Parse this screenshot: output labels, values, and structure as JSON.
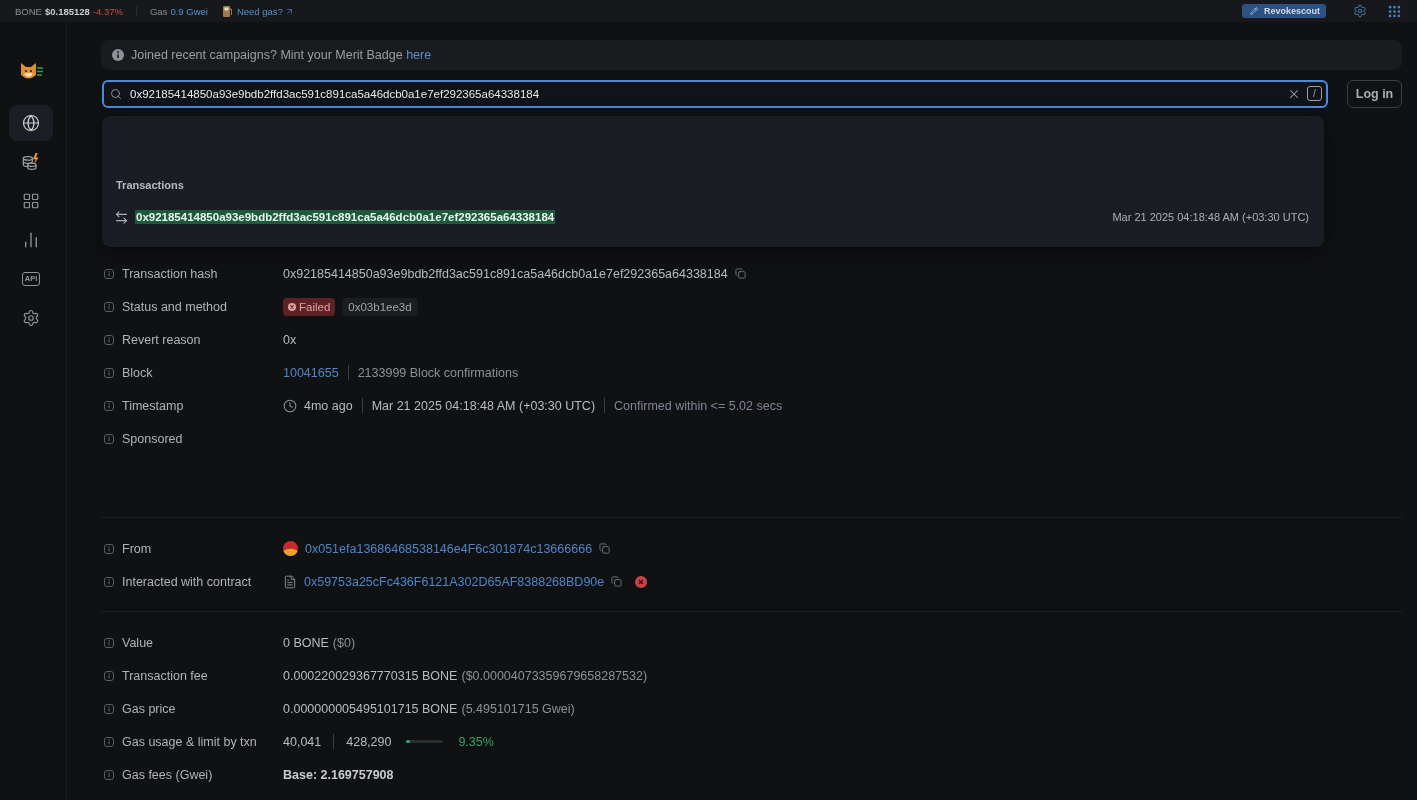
{
  "top_bar": {
    "token": "BONE",
    "price": "$0.185128",
    "change": "-4.37%",
    "negative": true,
    "gas_label": "Gas",
    "gas_price": "0.9 Gwei",
    "gas_link": "Need gas?",
    "revoke_button": "Revokescout"
  },
  "sidebar": {
    "items": [
      {
        "selected": true
      },
      {
        "selected": false
      },
      {
        "selected": false
      },
      {
        "selected": false
      },
      {
        "selected": false,
        "label": "API"
      },
      {
        "selected": false
      }
    ]
  },
  "alert": {
    "text": "Joined recent campaigns? Mint your Merit Badge",
    "link": "here"
  },
  "search": {
    "value": "0x92185414850a93e9bdb2ffd3ac591c891ca5a46dcb0a1e7ef292365a64338184",
    "shortcut": "/",
    "focused": true
  },
  "login_button": "Log in",
  "search_results": {
    "heading": "Transactions",
    "items": [
      {
        "hash": "0x92185414850a93e9bdb2ffd3ac591c891ca5a46dcb0a1e7ef292365a64338184",
        "timestamp": "Mar 21 2025 04:18:48 AM (+03:30 UTC)"
      }
    ]
  },
  "details": {
    "sections": [
      {
        "rows": [
          {
            "kind": "hash",
            "label": "Transaction hash",
            "value": "0x92185414850a93e9bdb2ffd3ac591c891ca5a46dcb0a1e7ef292365a64338184"
          },
          {
            "kind": "status",
            "label": "Status and method",
            "status": {
              "text": "Failed",
              "failed": true
            },
            "method": "0x03b1ee3d"
          },
          {
            "kind": "text",
            "label": "Revert reason",
            "value": "0x"
          },
          {
            "kind": "block",
            "label": "Block",
            "block": "10041655",
            "confirmations": "2133999 Block confirmations"
          },
          {
            "kind": "timestamp",
            "label": "Timestamp",
            "age": "4mo ago",
            "date": "Mar 21 2025 04:18:48 AM (+03:30 UTC)",
            "confirmed": "Confirmed within <= 5.02 secs"
          },
          {
            "kind": "text",
            "label": "Sponsored"
          }
        ]
      },
      {
        "rows": [
          {
            "kind": "account",
            "label": "From",
            "address": "0x051efa13686468538146e4F6c301874c13666666"
          },
          {
            "kind": "contract",
            "label": "Interacted with contract",
            "address": "0x59753a25cFc436F6121A302D65AF8388268BD90e",
            "failed": true
          }
        ]
      },
      {
        "rows": [
          {
            "kind": "amount",
            "label": "Value",
            "amount": "0 BONE",
            "note": "($0)"
          },
          {
            "kind": "amount",
            "label": "Transaction fee",
            "amount": "0.000220029367770315 BONE",
            "note": "($0.00004073359679658287532)"
          },
          {
            "kind": "amount",
            "label": "Gas price",
            "amount": "0.000000005495101715 BONE",
            "note": "(5.495101715 Gwei)"
          },
          {
            "kind": "gas_usage",
            "label": "Gas usage & limit by txn",
            "used": "40,041",
            "limit": "428,290",
            "level": 0.0935,
            "percent": "9.35%"
          },
          {
            "kind": "fee",
            "label": "Gas fees (Gwei)",
            "value": "Base: 2.169757908"
          }
        ]
      }
    ]
  }
}
